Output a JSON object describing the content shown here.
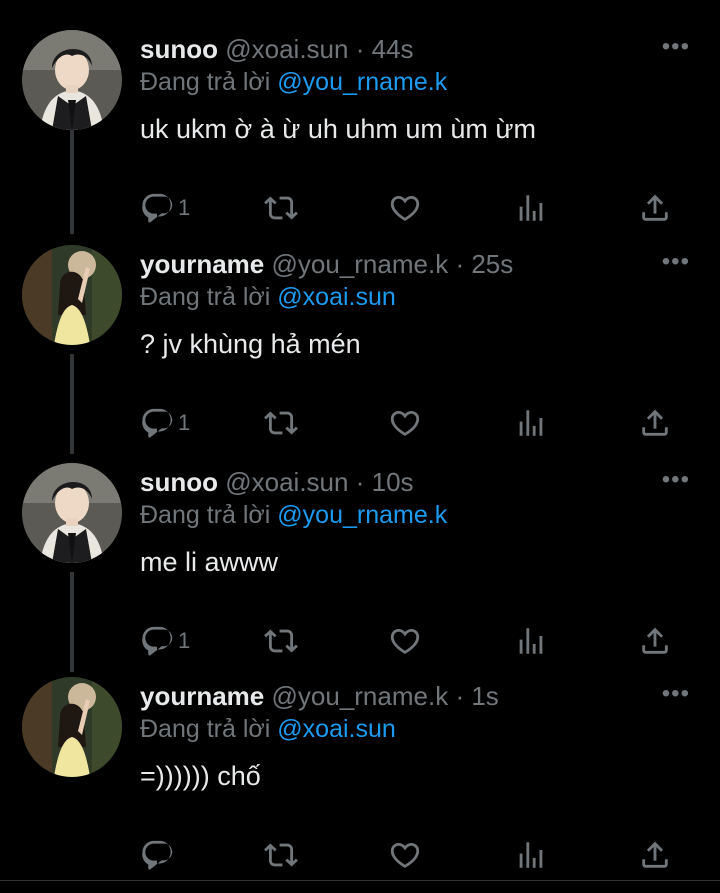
{
  "colors": {
    "background": "#000000",
    "text": "#e7e9ea",
    "muted": "#71767b",
    "mention": "#1d9bf0",
    "thread_line": "#333639"
  },
  "tweets": [
    {
      "avatar": "avatar-sunoo",
      "name": "sunoo",
      "handle": "@xoai.sun",
      "dot": "·",
      "time": "44s",
      "more": "•••",
      "reply_prefix": "Đang trả lời",
      "reply_to": "@you_rname.k",
      "text": "uk ukm ờ à ừ uh uhm um ùm ừm",
      "reply_count": "1"
    },
    {
      "avatar": "avatar-yourname",
      "name": "yourname",
      "handle": "@you_rname.k",
      "dot": "·",
      "time": "25s",
      "more": "•••",
      "reply_prefix": "Đang trả lời",
      "reply_to": "@xoai.sun",
      "text": "? jv khùng hả mén",
      "reply_count": "1"
    },
    {
      "avatar": "avatar-sunoo",
      "name": "sunoo",
      "handle": "@xoai.sun",
      "dot": "·",
      "time": "10s",
      "more": "•••",
      "reply_prefix": "Đang trả lời",
      "reply_to": "@you_rname.k",
      "text": "me li awww",
      "reply_count": "1"
    },
    {
      "avatar": "avatar-yourname",
      "name": "yourname",
      "handle": "@you_rname.k",
      "dot": "·",
      "time": "1s",
      "more": "•••",
      "reply_prefix": "Đang trả lời",
      "reply_to": "@xoai.sun",
      "text": "=)))))) chố",
      "reply_count": ""
    }
  ],
  "action_icons": [
    "reply-icon",
    "retweet-icon",
    "like-icon",
    "analytics-icon",
    "share-icon"
  ]
}
